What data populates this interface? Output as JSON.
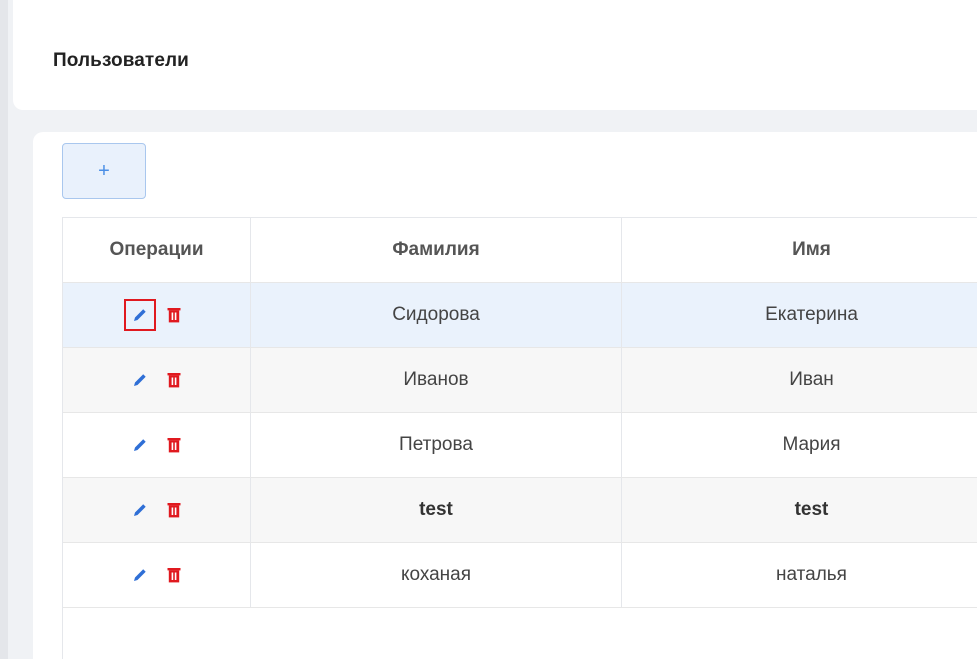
{
  "page": {
    "title": "Пользователи"
  },
  "toolbar": {
    "add_label": "+"
  },
  "table": {
    "columns": [
      "Операции",
      "Фамилия",
      "Имя"
    ],
    "rows": [
      {
        "last_name": "Сидорова",
        "first_name": "Екатерина",
        "selected": true,
        "bold": false
      },
      {
        "last_name": "Иванов",
        "first_name": "Иван",
        "selected": false,
        "bold": false
      },
      {
        "last_name": "Петрова",
        "first_name": "Мария",
        "selected": false,
        "bold": false
      },
      {
        "last_name": "test",
        "first_name": "test",
        "selected": false,
        "bold": true
      },
      {
        "last_name": "коханая",
        "first_name": "наталья",
        "selected": false,
        "bold": false
      }
    ]
  },
  "icons": {
    "edit": "pencil-icon",
    "delete": "trash-icon"
  },
  "colors": {
    "edit_icon": "#2f6fd6",
    "delete_icon": "#e0191f",
    "selected_row": "#eaf2fc",
    "highlight_outline": "#e0191f"
  }
}
